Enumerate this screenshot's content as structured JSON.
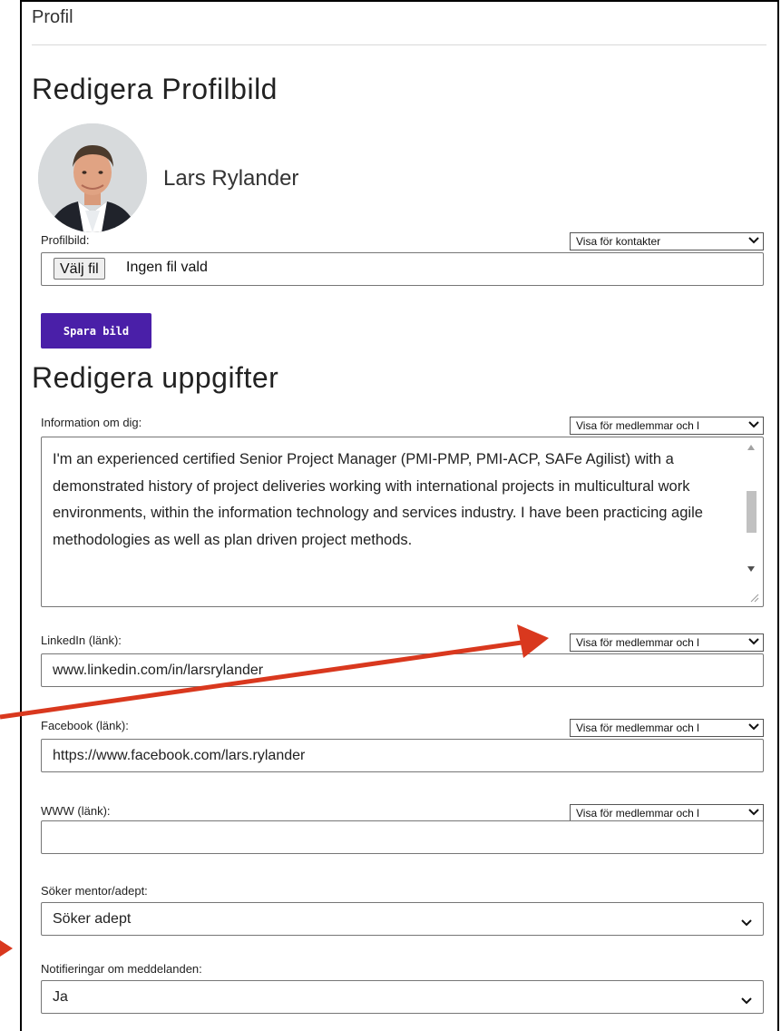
{
  "breadcrumb": "Profil",
  "photo_section": {
    "title": "Redigera Profilbild",
    "user_name": "Lars Rylander",
    "field_label": "Profilbild:",
    "visibility": "Visa för kontakter",
    "file_button": "Välj fil",
    "file_status": "Ingen fil vald",
    "save_button": "Spara bild"
  },
  "info_section": {
    "title": "Redigera uppgifter",
    "about": {
      "label": "Information om dig:",
      "visibility": "Visa för medlemmar och l",
      "value": "I'm an experienced certified Senior Project Manager (PMI-PMP, PMI-ACP, SAFe Agilist) with a demonstrated history of project deliveries working with international projects in multicultural work environments, within the information technology and services industry. I have been practicing agile methodologies as well as plan driven project methods."
    },
    "linkedin": {
      "label": "LinkedIn (länk):",
      "visibility": "Visa för medlemmar och l",
      "value": "www.linkedin.com/in/larsrylander"
    },
    "facebook": {
      "label": "Facebook (länk):",
      "visibility": "Visa för medlemmar och l",
      "value": "https://www.facebook.com/lars.rylander"
    },
    "www": {
      "label": "WWW (länk):",
      "visibility": "Visa för medlemmar och l",
      "value": ""
    },
    "mentor": {
      "label": "Söker mentor/adept:",
      "value": "Söker adept"
    },
    "notifications": {
      "label": "Notifieringar om meddelanden:",
      "value": "Ja"
    }
  },
  "colors": {
    "save_button_bg": "#4a1fa8",
    "annotation_arrow": "#d9381e"
  },
  "icons": [
    "chevron-down-icon",
    "scroll-up-icon",
    "scroll-down-icon",
    "resize-grip-icon",
    "avatar-photo"
  ]
}
